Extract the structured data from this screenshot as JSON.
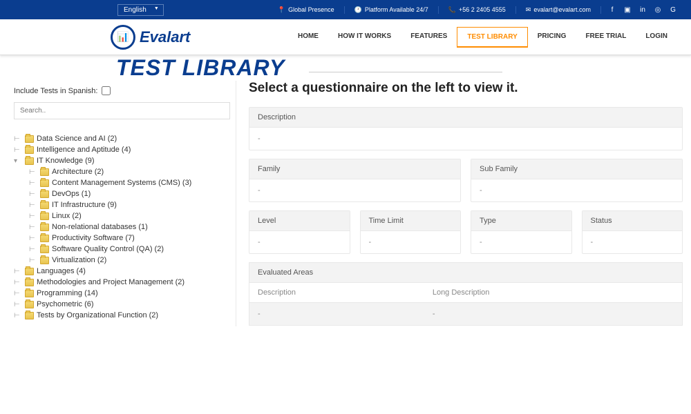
{
  "topbar": {
    "language": "English",
    "links": [
      {
        "icon": "📍",
        "text": "Global Presence"
      },
      {
        "icon": "🕐",
        "text": "Platform Available 24/7"
      },
      {
        "icon": "📞",
        "text": "+56 2 2405 4555"
      },
      {
        "icon": "✉",
        "text": "evalart@evalart.com"
      }
    ]
  },
  "logo": "Evalart",
  "nav": [
    {
      "label": "HOME",
      "active": false
    },
    {
      "label": "HOW IT WORKS",
      "active": false
    },
    {
      "label": "FEATURES",
      "active": false
    },
    {
      "label": "TEST LIBRARY",
      "active": true
    },
    {
      "label": "PRICING",
      "active": false
    },
    {
      "label": "FREE TRIAL",
      "active": false
    },
    {
      "label": "LOGIN",
      "active": false
    }
  ],
  "page_title": "TEST LIBRARY",
  "sidebar": {
    "spanish_label": "Include Tests in Spanish:",
    "search_placeholder": "Search..",
    "tree": [
      {
        "label": "Data Science and AI (2)",
        "child": false
      },
      {
        "label": "Intelligence and Aptitude (4)",
        "child": false
      },
      {
        "label": "IT Knowledge (9)",
        "child": false,
        "expanded": true
      },
      {
        "label": "Architecture (2)",
        "child": true
      },
      {
        "label": "Content Management Systems (CMS) (3)",
        "child": true
      },
      {
        "label": "DevOps (1)",
        "child": true
      },
      {
        "label": "IT Infrastructure (9)",
        "child": true
      },
      {
        "label": "Linux (2)",
        "child": true
      },
      {
        "label": "Non-relational databases (1)",
        "child": true
      },
      {
        "label": "Productivity Software (7)",
        "child": true
      },
      {
        "label": "Software Quality Control (QA) (2)",
        "child": true
      },
      {
        "label": "Virtualization (2)",
        "child": true
      },
      {
        "label": "Languages (4)",
        "child": false
      },
      {
        "label": "Methodologies and Project Management (2)",
        "child": false
      },
      {
        "label": "Programming (14)",
        "child": false
      },
      {
        "label": "Psychometric (6)",
        "child": false
      },
      {
        "label": "Tests by Organizational Function (2)",
        "child": false
      }
    ]
  },
  "main": {
    "heading": "Select a questionnaire on the left to view it.",
    "description_label": "Description",
    "description_value": "-",
    "family_label": "Family",
    "family_value": "-",
    "subfamily_label": "Sub Family",
    "subfamily_value": "-",
    "level_label": "Level",
    "level_value": "-",
    "timelimit_label": "Time Limit",
    "timelimit_value": "-",
    "type_label": "Type",
    "type_value": "-",
    "status_label": "Status",
    "status_value": "-",
    "eval_header": "Evaluated Areas",
    "eval_col1": "Description",
    "eval_col2": "Long Description",
    "eval_val1": "-",
    "eval_val2": "-"
  }
}
